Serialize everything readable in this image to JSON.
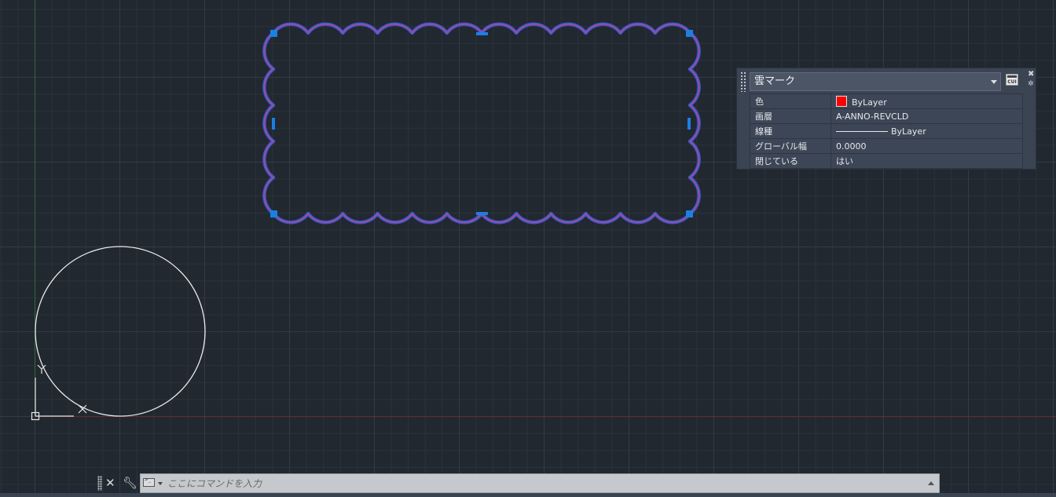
{
  "quick_properties": {
    "object_type": "雲マーク",
    "rows": [
      {
        "label": "色",
        "value": "ByLayer"
      },
      {
        "label": "画層",
        "value": "A-ANNO-REVCLD"
      },
      {
        "label": "線種",
        "value": "ByLayer"
      },
      {
        "label": "グローバル幅",
        "value": "0.0000"
      },
      {
        "label": "閉じている",
        "value": "はい"
      }
    ],
    "cui_label": "CUI"
  },
  "command_line": {
    "placeholder": "ここにコマンドを入力"
  },
  "colors": {
    "background": "#212830",
    "revcloud": "#7b4fb4",
    "grip": "#1c7fe3",
    "color_swatch": "#ff0000",
    "x_axis": "#7a2a2a",
    "y_axis": "#2f6b34"
  },
  "icons": {
    "close": "close-icon",
    "settings": "gear-icon",
    "customize": "cui-icon",
    "command_close": "close-icon",
    "customize_command": "wrench-icon",
    "command_prompt": "terminal-icon",
    "ucs": "ucs-icon"
  }
}
